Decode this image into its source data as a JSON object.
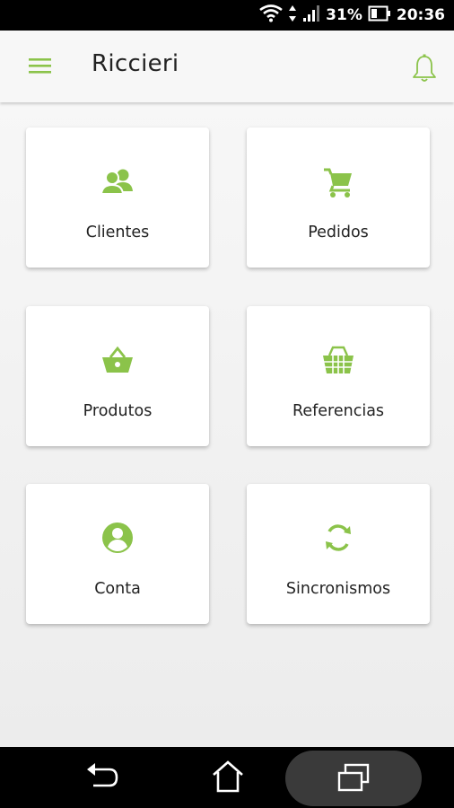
{
  "status": {
    "battery": "31%",
    "time": "20:36"
  },
  "appbar": {
    "title": "Riccieri"
  },
  "menu": [
    {
      "label": "Clientes",
      "icon": "clients-icon"
    },
    {
      "label": "Pedidos",
      "icon": "cart-icon"
    },
    {
      "label": "Produtos",
      "icon": "basket-icon"
    },
    {
      "label": "Referencias",
      "icon": "grid-basket-icon"
    },
    {
      "label": "Conta",
      "icon": "account-icon"
    },
    {
      "label": "Sincronismos",
      "icon": "sync-icon"
    }
  ],
  "colors": {
    "accent": "#8bc34a",
    "background": "#f2f2f2"
  }
}
